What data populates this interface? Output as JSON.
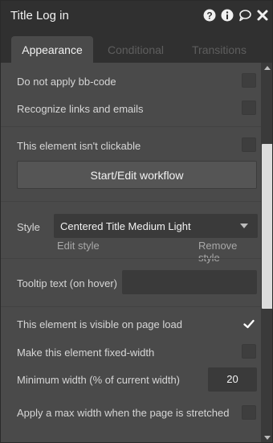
{
  "window": {
    "title": "Title Log in",
    "icons": [
      "help-icon",
      "info-icon",
      "comment-icon",
      "close-icon"
    ]
  },
  "tabs": [
    {
      "label": "Appearance",
      "active": true
    },
    {
      "label": "Conditional",
      "active": false
    },
    {
      "label": "Transitions",
      "active": false
    }
  ],
  "options": {
    "no_bbcode": {
      "label": "Do not apply bb-code",
      "checked": false
    },
    "recognize_links": {
      "label": "Recognize links and emails",
      "checked": false
    },
    "not_clickable": {
      "label": "This element isn't clickable",
      "checked": false
    },
    "visible_on_load": {
      "label": "This element is visible on page load",
      "checked": true
    },
    "fixed_width": {
      "label": "Make this element fixed-width",
      "checked": false
    },
    "max_width": {
      "label": "Apply a max width when the page is stretched",
      "checked": false
    }
  },
  "workflow_button": "Start/Edit workflow",
  "style": {
    "label": "Style",
    "selected": "Centered Title Medium Light",
    "edit_link": "Edit style",
    "remove_link": "Remove style"
  },
  "tooltip": {
    "label": "Tooltip text (on hover)",
    "value": ""
  },
  "min_width": {
    "label": "Minimum width (% of current width)",
    "value": "20"
  },
  "colors": {
    "background": "#4a4a4a",
    "titlebar": "#303030",
    "input": "#3a3a3a",
    "text": "#d6d6d6",
    "inactive_tab": "#5e5e5e"
  }
}
